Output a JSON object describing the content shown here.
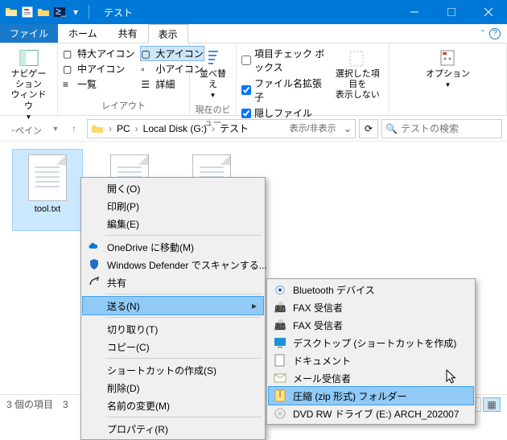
{
  "window": {
    "title": "テスト"
  },
  "tabs": {
    "file": "ファイル",
    "home": "ホーム",
    "share": "共有",
    "view": "表示"
  },
  "ribbon": {
    "panes": {
      "nav": "ナビゲーション\nウィンドウ",
      "group": "ペイン"
    },
    "layout": {
      "xl": "特大アイコン",
      "l": "大アイコン",
      "m": "中アイコン",
      "s": "小アイコン",
      "list": "一覧",
      "details": "詳細",
      "group": "レイアウト"
    },
    "sort": {
      "btn": "並べ替え",
      "group": "現在のビュー"
    },
    "show": {
      "checkboxes": "項目チェック ボックス",
      "ext": "ファイル名拡張子",
      "hidden": "隠しファイル",
      "hidebtn": "選択した項目を\n表示しない",
      "group": "表示/非表示"
    },
    "options": "オプション"
  },
  "address": {
    "pc": "PC",
    "drive": "Local Disk (G:)",
    "folder": "テスト"
  },
  "search": {
    "placeholder": "テストの検索"
  },
  "files": [
    {
      "name": "tool.txt",
      "selected": true
    },
    {
      "name": "",
      "selected": false
    },
    {
      "name": "",
      "selected": false
    }
  ],
  "status": {
    "count": "3 個の項目",
    "sel": "3"
  },
  "ctx": {
    "open": "開く(O)",
    "print": "印刷(P)",
    "edit": "編集(E)",
    "onedrive": "OneDrive に移動(M)",
    "defender": "Windows Defender でスキャンする...",
    "share": "共有",
    "sendto": "送る(N)",
    "cut": "切り取り(T)",
    "copy": "コピー(C)",
    "shortcut": "ショートカットの作成(S)",
    "delete": "削除(D)",
    "rename": "名前の変更(M)",
    "props": "プロパティ(R)"
  },
  "sendto": {
    "bluetooth": "Bluetooth デバイス",
    "fax1": "FAX 受信者",
    "fax2": "FAX 受信者",
    "desktop": "デスクトップ (ショートカットを作成)",
    "docs": "ドキュメント",
    "mail": "メール受信者",
    "zip": "圧縮 (zip 形式) フォルダー",
    "dvd": "DVD RW ドライブ (E:) ARCH_202007"
  }
}
